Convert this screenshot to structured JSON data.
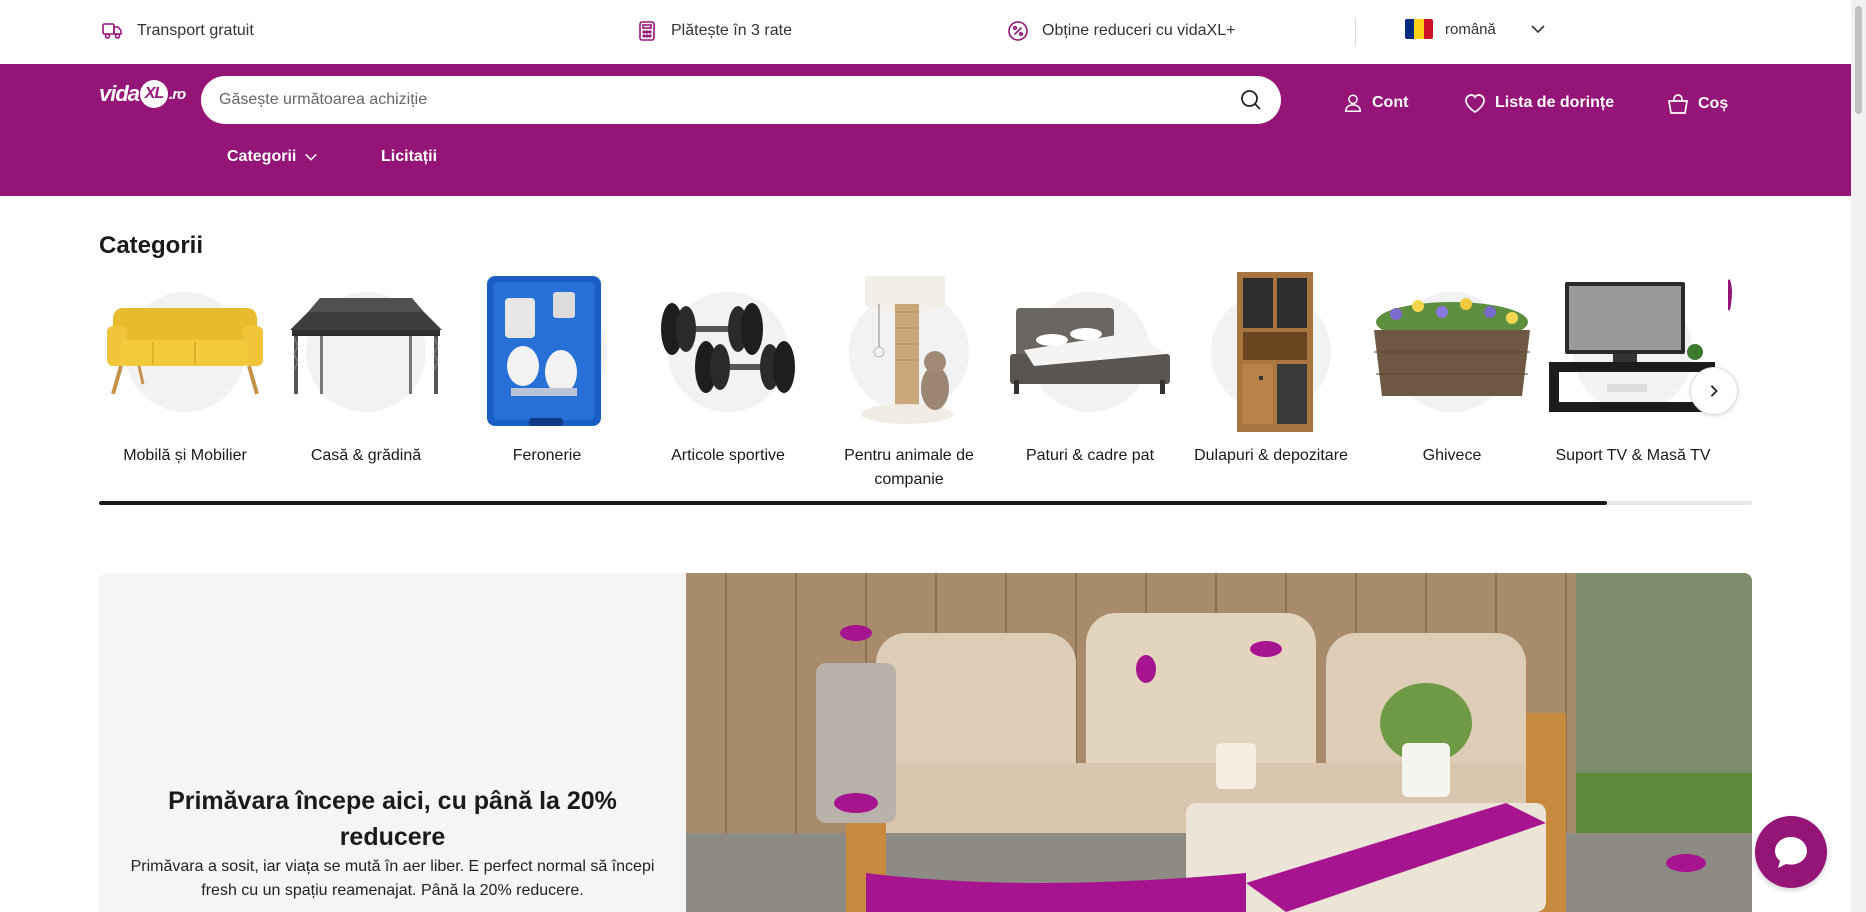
{
  "usp": {
    "shipping": {
      "label": "Transport gratuit",
      "icon": "truck-icon"
    },
    "installments": {
      "label": "Plătește în 3 rate",
      "icon": "calculator-icon"
    },
    "plus": {
      "label": "Obține reduceri cu vidaXL+",
      "icon": "percent-badge-icon"
    }
  },
  "language": {
    "label": "română",
    "flag_colors": [
      "#002B7F",
      "#FCD116",
      "#CE1126"
    ]
  },
  "header": {
    "brand_color": "#951478",
    "logo": {
      "prefix": "vida",
      "mark": "XL",
      "suffix": ".ro"
    },
    "search_placeholder": "Găsește următoarea achiziție",
    "account_label": "Cont",
    "wishlist_label": "Lista de dorințe",
    "cart_label": "Coș"
  },
  "nav": {
    "categories_label": "Categorii",
    "auctions_label": "Licitații"
  },
  "categories": {
    "title": "Categorii",
    "items": [
      {
        "label": "Mobilă și Mobilier",
        "image": "yellow-sofa"
      },
      {
        "label": "Casă & grădină",
        "image": "gazebo"
      },
      {
        "label": "Feronerie",
        "image": "spray-gun-kit"
      },
      {
        "label": "Articole sportive",
        "image": "dumbbells"
      },
      {
        "label": "Pentru animale de companie",
        "image": "cat-tree"
      },
      {
        "label": "Paturi & cadre pat",
        "image": "bed-frame"
      },
      {
        "label": "Dulapuri & depozitare",
        "image": "wooden-cabinet"
      },
      {
        "label": "Ghivece",
        "image": "flower-planter"
      },
      {
        "label": "Suport TV & Masă TV",
        "image": "tv-stand"
      },
      {
        "label": "",
        "image": "partial-item"
      }
    ],
    "scroll_progress": 0.912
  },
  "promo": {
    "title": "Primăvara începe aici, cu până la 20% reducere",
    "description": "Primăvara a sosit, iar viața se mută în aer liber. E perfect normal să începi fresh cu un spațiu reamenajat. Până la 20% reducere."
  },
  "chat": {
    "icon": "chat-bubble-icon"
  }
}
